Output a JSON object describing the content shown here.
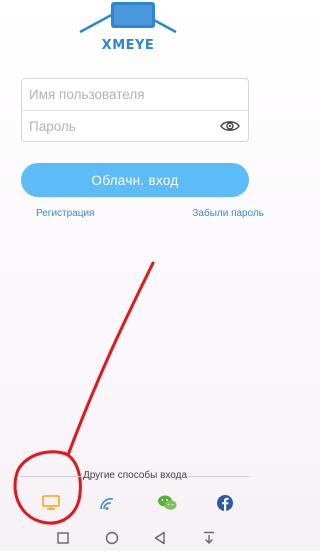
{
  "app": {
    "logo_text": "XMEYE"
  },
  "login": {
    "username_placeholder": "Имя пользователя",
    "password_placeholder": "Пароль",
    "submit_label": "Облачн. вход"
  },
  "links": {
    "register": "Регистрация",
    "forgot_password": "Забыли пароль"
  },
  "other_login": {
    "title": "Другие способы входа",
    "options": [
      {
        "name": "local-device",
        "icon": "monitor-icon",
        "color": "#f2a818"
      },
      {
        "name": "wifi-ap",
        "icon": "wifi-icon",
        "color": "#3d8fd6"
      },
      {
        "name": "wechat",
        "icon": "wechat-icon",
        "color": "#55b037"
      },
      {
        "name": "facebook",
        "icon": "facebook-icon",
        "color": "#2d5aa8"
      }
    ]
  },
  "system_nav": [
    "recent-apps",
    "home",
    "back",
    "notifications"
  ],
  "annotation": {
    "color": "#e8141b",
    "target": "local-device"
  },
  "colors": {
    "accent": "#5cbcf7",
    "link": "#3a8bd0",
    "logo": "#2b86d6"
  }
}
